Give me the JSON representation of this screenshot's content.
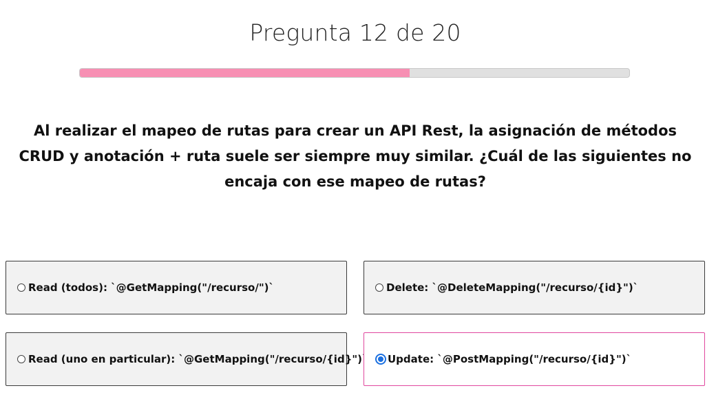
{
  "header": {
    "title": "Pregunta 12 de 20"
  },
  "progress": {
    "fraction": 0.6,
    "color": "#f78fb3"
  },
  "question": {
    "text": "Al realizar el mapeo de rutas para crear un API Rest, la asignación de métodos CRUD y anotación + ruta suele ser siempre muy similar. ¿Cuál de las siguientes no encaja con ese mapeo de rutas?"
  },
  "options": [
    {
      "label": "Read (todos): `@GetMapping(\"/recurso/\")`",
      "selected": false
    },
    {
      "label": "Delete: `@DeleteMapping(\"/recurso/{id}\")`",
      "selected": false
    },
    {
      "label": "Read (uno en particular): `@GetMapping(\"/recurso/{id}\")`",
      "selected": false
    },
    {
      "label": "Update: `@PostMapping(\"/recurso/{id}\")`",
      "selected": true
    }
  ],
  "colors": {
    "selected_border": "#e0479e",
    "radio_checked": "#1a6fe0"
  }
}
